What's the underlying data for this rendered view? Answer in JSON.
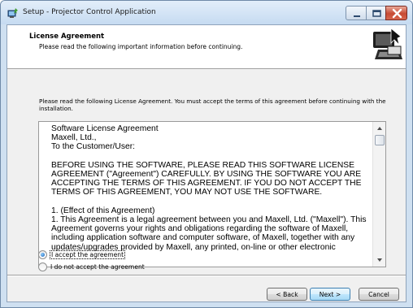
{
  "window": {
    "title": "Setup - Projector Control Application",
    "icon": "setup-computer-icon"
  },
  "header": {
    "title": "License Agreement",
    "subtitle": "Please read the following important information before continuing."
  },
  "intro": "Please read the following License Agreement. You must accept the terms of this agreement before continuing with the installation.",
  "license": {
    "lines": [
      "Software License Agreement",
      "Maxell, Ltd.,",
      "To the Customer/User:",
      "",
      "BEFORE USING THE SOFTWARE, PLEASE READ THIS SOFTWARE LICENSE",
      "AGREEMENT (\"Agreement\") CAREFULLY. BY USING THE SOFTWARE YOU ARE",
      "ACCEPTING THE TERMS OF THIS AGREEMENT. IF YOU DO NOT ACCEPT THE",
      "TERMS OF THIS AGREEMENT, YOU MAY NOT USE THE SOFTWARE.",
      "",
      "1. (Effect of this Agreement)",
      "1. This Agreement is a legal agreement between you and Maxell, Ltd. (\"Maxell\"). This",
      "Agreement governs your rights and obligations regarding the software of Maxell,",
      "including application software and computer software, of Maxell, together with any",
      "updates/upgrades provided by Maxell, any printed, on-line or other electronic"
    ]
  },
  "options": {
    "accept": "I accept the agreement",
    "decline": "I do not accept the agreement",
    "selected": "accept"
  },
  "buttons": {
    "back": "< Back",
    "next": "Next >",
    "cancel": "Cancel"
  }
}
